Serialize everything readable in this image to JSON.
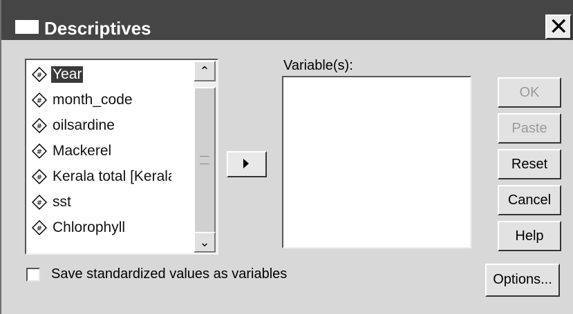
{
  "window": {
    "title": "Descriptives",
    "close_glyph": "✕"
  },
  "source_list": {
    "items": [
      {
        "label": "Year",
        "selected": true,
        "icon": "scale-variable-icon"
      },
      {
        "label": "month_code",
        "selected": false,
        "icon": "scale-variable-icon"
      },
      {
        "label": "oilsardine",
        "selected": false,
        "icon": "scale-variable-icon"
      },
      {
        "label": "Mackerel",
        "selected": false,
        "icon": "scale-variable-icon"
      },
      {
        "label": "Kerala total [Keralat",
        "selected": false,
        "icon": "scale-variable-icon"
      },
      {
        "label": "sst",
        "selected": false,
        "icon": "scale-variable-icon"
      },
      {
        "label": "Chlorophyll",
        "selected": false,
        "icon": "scale-variable-icon"
      }
    ],
    "scroll_up_glyph": "⌃",
    "scroll_down_glyph": "⌄"
  },
  "target": {
    "label": "Variable(s):"
  },
  "buttons": {
    "ok": "OK",
    "paste": "Paste",
    "reset": "Reset",
    "cancel": "Cancel",
    "help": "Help",
    "options": "Options..."
  },
  "save_standardized": {
    "label": "Save standardized values as variables",
    "checked": false
  },
  "colors": {
    "titlebar": "#454545",
    "dialog_bg": "#d8d8d8",
    "selection": "#3a3a3a"
  }
}
